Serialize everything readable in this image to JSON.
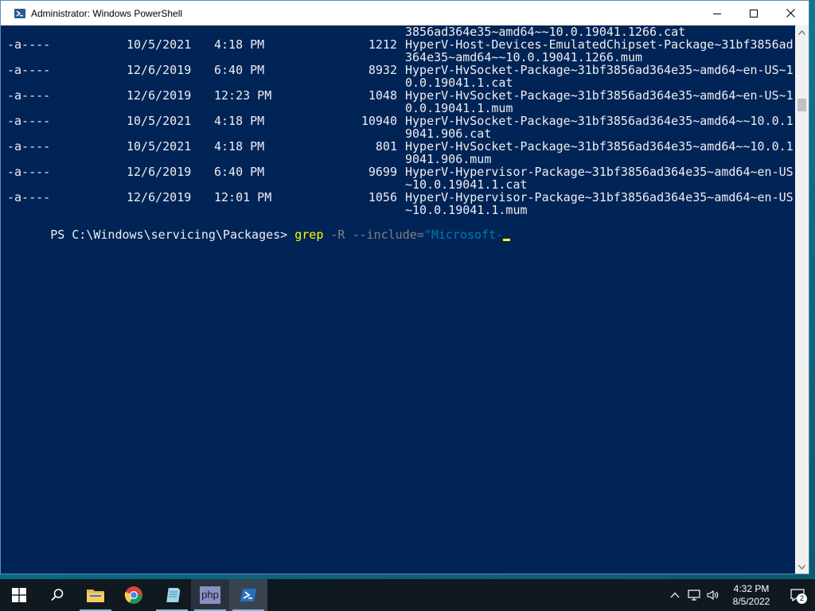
{
  "window": {
    "title": "Administrator: Windows PowerShell",
    "minimize_icon": "minimize-icon",
    "maximize_icon": "maximize-icon",
    "close_icon": "close-icon"
  },
  "console": {
    "top_fragment": "3856ad364e35~amd64~~10.0.19041.1266.cat",
    "rows": [
      {
        "mode": "-a----",
        "date": "10/5/2021",
        "time": "4:18 PM",
        "length": "1212",
        "name": "HyperV-Host-Devices-EmulatedChipset-Package~31bf3856ad364e35~amd64~~10.0.19041.1266.mum"
      },
      {
        "mode": "-a----",
        "date": "12/6/2019",
        "time": "6:40 PM",
        "length": "8932",
        "name": "HyperV-HvSocket-Package~31bf3856ad364e35~amd64~en-US~10.0.19041.1.cat"
      },
      {
        "mode": "-a----",
        "date": "12/6/2019",
        "time": "12:23 PM",
        "length": "1048",
        "name": "HyperV-HvSocket-Package~31bf3856ad364e35~amd64~en-US~10.0.19041.1.mum"
      },
      {
        "mode": "-a----",
        "date": "10/5/2021",
        "time": "4:18 PM",
        "length": "10940",
        "name": "HyperV-HvSocket-Package~31bf3856ad364e35~amd64~~10.0.19041.906.cat"
      },
      {
        "mode": "-a----",
        "date": "10/5/2021",
        "time": "4:18 PM",
        "length": "801",
        "name": "HyperV-HvSocket-Package~31bf3856ad364e35~amd64~~10.0.19041.906.mum"
      },
      {
        "mode": "-a----",
        "date": "12/6/2019",
        "time": "6:40 PM",
        "length": "9699",
        "name": "HyperV-Hypervisor-Package~31bf3856ad364e35~amd64~en-US~10.0.19041.1.cat"
      },
      {
        "mode": "-a----",
        "date": "12/6/2019",
        "time": "12:01 PM",
        "length": "1056",
        "name": "HyperV-Hypervisor-Package~31bf3856ad364e35~amd64~en-US~10.0.19041.1.mum"
      }
    ],
    "prompt": "PS C:\\Windows\\servicing\\Packages> ",
    "command": "grep",
    "params": " -R --include=",
    "string_arg": "\"Microsoft-"
  },
  "taskbar": {
    "items": [
      {
        "name": "start-button",
        "icon": "windows-logo-icon"
      },
      {
        "name": "search-button",
        "icon": "search-icon"
      },
      {
        "name": "file-explorer-button",
        "icon": "folder-icon"
      },
      {
        "name": "chrome-button",
        "icon": "chrome-icon"
      },
      {
        "name": "notepad-button",
        "icon": "notepad-icon"
      },
      {
        "name": "php-button",
        "icon": "php-icon",
        "label": "php"
      },
      {
        "name": "powershell-button",
        "icon": "powershell-icon"
      }
    ],
    "clock_time": "4:32 PM",
    "clock_date": "8/5/2022",
    "notification_count": "2"
  },
  "colors": {
    "console_bg": "#012456",
    "console_fg": "#eeedf0",
    "cmd_yellow": "#ffff00",
    "param_gray": "#808080",
    "string_cyan": "#00bfff"
  }
}
